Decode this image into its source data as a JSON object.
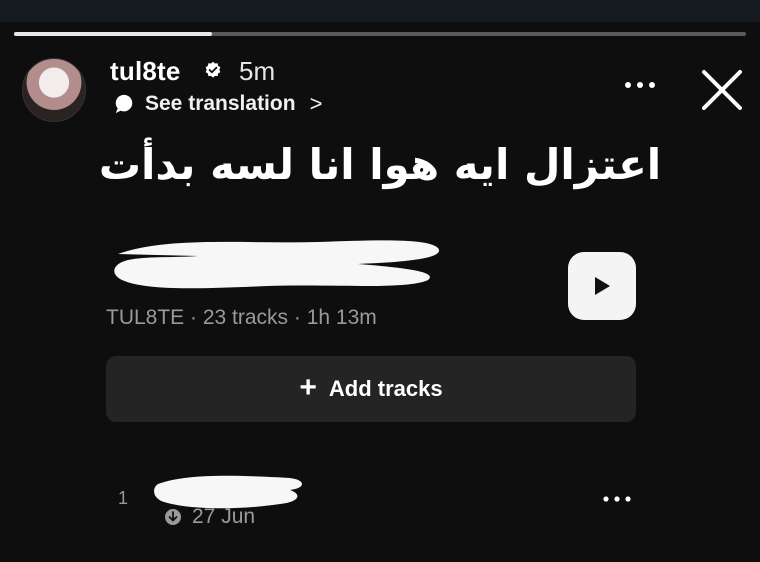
{
  "story": {
    "progress_fraction": 0.27
  },
  "header": {
    "username": "tul8te",
    "time_ago": "5m",
    "translate_label": "See translation",
    "chevron": ">"
  },
  "caption": "اعتزال ايه هوا انا لسه بدأت",
  "playlist": {
    "meta": "TUL8TE · 23 tracks · 1h 13m",
    "add_label": "Add tracks",
    "plus": "+"
  },
  "tracks": [
    {
      "number": "1",
      "date": "27 Jun"
    }
  ],
  "icons": {
    "verified": "verified-badge-icon",
    "translate": "translate-bubble-icon",
    "more": "more-icon",
    "close": "close-icon",
    "play": "play-icon",
    "download": "download-icon"
  }
}
